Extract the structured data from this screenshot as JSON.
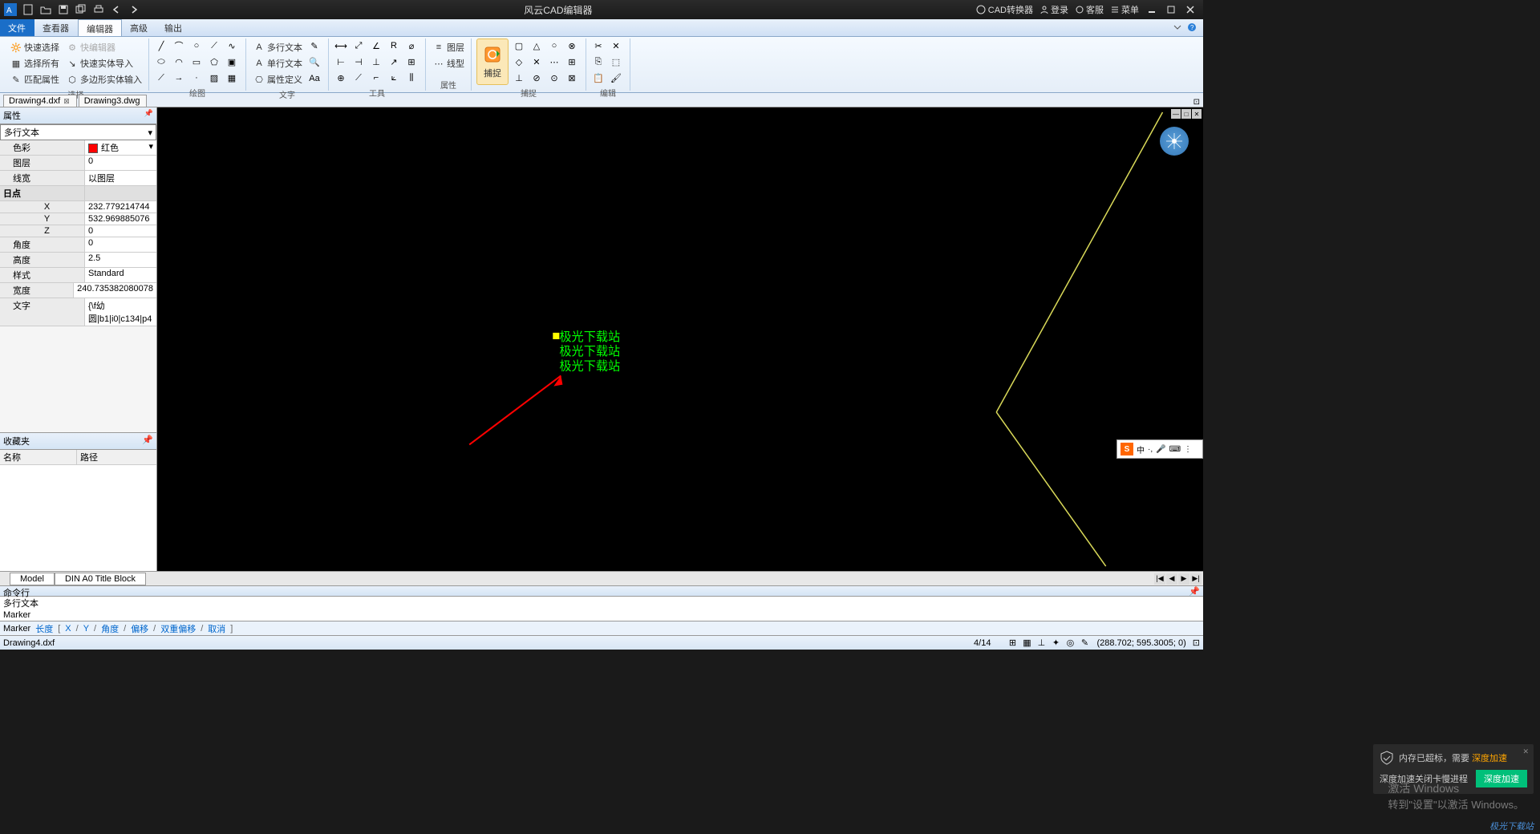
{
  "title_bar": {
    "app_title": "风云CAD编辑器",
    "converter": "CAD转换器",
    "login": "登录",
    "service": "客服",
    "menu": "菜单"
  },
  "menu_tabs": {
    "file": "文件",
    "viewer": "查看器",
    "editor": "编辑器",
    "advanced": "高级",
    "output": "输出"
  },
  "ribbon": {
    "select": {
      "label": "选择",
      "quick_select": "快速选择",
      "select_all": "选择所有",
      "match_props": "匹配属性",
      "quick_edit": "快编辑器",
      "fast_import": "快速实体导入",
      "polygon_input": "多边形实体输入"
    },
    "draw": {
      "label": "绘图"
    },
    "text": {
      "label": "文字",
      "mtext": "多行文本",
      "stext": "单行文本",
      "attdef": "属性定义"
    },
    "tools": {
      "label": "工具"
    },
    "props": {
      "label": "属性",
      "layer": "图层",
      "linetype": "线型"
    },
    "snap": {
      "label": "捕捉",
      "btn": "捕捉"
    },
    "edit": {
      "label": "编辑"
    }
  },
  "doc_tabs": {
    "t1": "Drawing4.dxf",
    "t2": "Drawing3.dwg"
  },
  "properties": {
    "title": "属性",
    "type": "多行文本",
    "color": {
      "label": "色彩",
      "value": "红色"
    },
    "layer": {
      "label": "图层",
      "value": "0"
    },
    "lineweight": {
      "label": "线宽",
      "value": "以图层"
    },
    "point_grp": "日点",
    "x": {
      "label": "X",
      "value": "232.779214744"
    },
    "y": {
      "label": "Y",
      "value": "532.969885076"
    },
    "z": {
      "label": "Z",
      "value": "0"
    },
    "angle": {
      "label": "角度",
      "value": "0"
    },
    "height": {
      "label": "高度",
      "value": "2.5"
    },
    "style": {
      "label": "样式",
      "value": "Standard"
    },
    "width": {
      "label": "宽度",
      "value": "240.735382080078"
    },
    "text": {
      "label": "文字",
      "value": "{\\f幼圆|b1|i0|c134|p4"
    }
  },
  "favorites": {
    "title": "收藏夹",
    "col1": "名称",
    "col2": "路径"
  },
  "canvas_text": {
    "line1": "极光下载站",
    "line2": "极光下载站",
    "line3": "极光下载站"
  },
  "model_tabs": {
    "model": "Model",
    "layout": "DIN A0 Title Block"
  },
  "command": {
    "title": "命令行",
    "line1": "多行文本",
    "line2": "Marker"
  },
  "marker_bar": {
    "marker": "Marker",
    "length": "长度",
    "x": "X",
    "y": "Y",
    "angle": "角度",
    "offset": "偏移",
    "double_offset": "双重偏移",
    "cancel": "取消"
  },
  "status_bar": {
    "file": "Drawing4.dxf",
    "page": "4/14",
    "coords": "(288.702; 595.3005; 0)"
  },
  "toast": {
    "msg1": "内存已超标，需要",
    "link1": "深度加速",
    "msg2": "深度加速关闭卡慢进程",
    "btn": "深度加速"
  },
  "win_activate": {
    "l1": "激活 Windows",
    "l2": "转到\"设置\"以激活 Windows。"
  },
  "watermark": "极光下载站"
}
